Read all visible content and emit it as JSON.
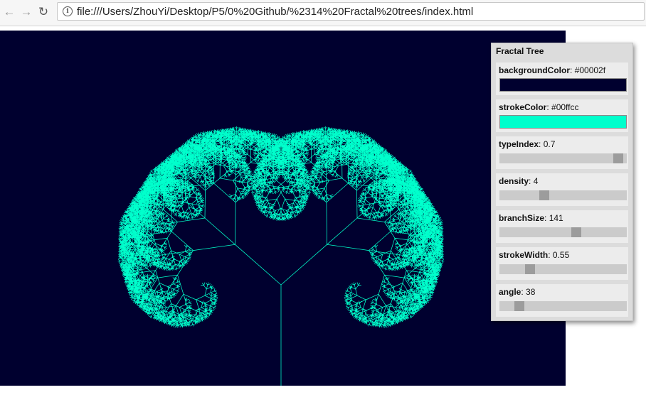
{
  "browser": {
    "url": "file:///Users/ZhouYi/Desktop/P5/0%20Github/%2314%20Fractal%20trees/index.html",
    "back_icon": "back-arrow-icon",
    "forward_icon": "forward-arrow-icon",
    "reload_icon": "reload-icon",
    "info_icon": "info-icon"
  },
  "canvas": {
    "background": "#00002f",
    "stroke": "#00ffcc"
  },
  "gui": {
    "title": "Fractal Tree",
    "controls": [
      {
        "label": "backgroundColor",
        "value": "#00002f",
        "type": "color"
      },
      {
        "label": "strokeColor",
        "value": "#00ffcc",
        "type": "color"
      },
      {
        "label": "typeIndex",
        "value": "0.7",
        "type": "slider",
        "fraction": 0.97
      },
      {
        "label": "density",
        "value": "4",
        "type": "slider",
        "fraction": 0.34
      },
      {
        "label": "branchSize",
        "value": "141",
        "type": "slider",
        "fraction": 0.61
      },
      {
        "label": "strokeWidth",
        "value": "0.55",
        "type": "slider",
        "fraction": 0.22
      },
      {
        "label": "angle",
        "value": "38",
        "type": "slider",
        "fraction": 0.13
      }
    ]
  }
}
